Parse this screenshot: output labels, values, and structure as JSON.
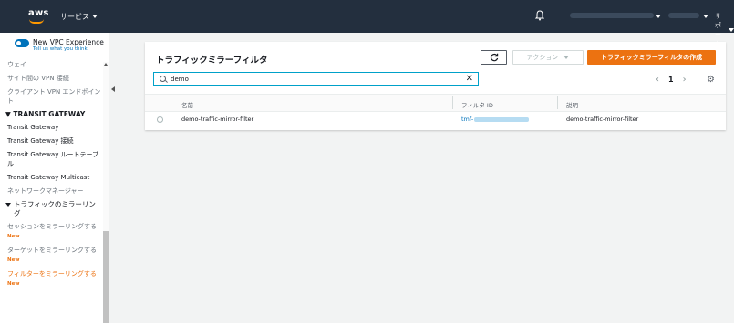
{
  "topnav": {
    "logo_text": "aws",
    "services_label": "サービス",
    "support_label": "サポート"
  },
  "sidebar": {
    "vpc_toggle": {
      "title": "New VPC Experience",
      "link": "Tell us what you think"
    },
    "items": [
      {
        "label": "ウェイ"
      },
      {
        "label": "サイト間の VPN 接続"
      },
      {
        "label": "クライアント VPN エンドポイント"
      }
    ],
    "transit_header": "TRANSIT GATEWAY",
    "transit_items": [
      {
        "label": "Transit Gateway"
      },
      {
        "label": "Transit Gateway 接続"
      },
      {
        "label": "Transit Gateway ルートテーブル"
      },
      {
        "label": "Transit Gateway Multicast"
      },
      {
        "label": "ネットワークマネージャー"
      }
    ],
    "mirroring_header": "トラフィックのミラーリング",
    "mirroring_items": [
      {
        "label": "セッションをミラーリングする",
        "badge": "New"
      },
      {
        "label": "ターゲットをミラーリングする",
        "badge": "New"
      },
      {
        "label": "フィルターをミラーリングする",
        "badge": "New"
      }
    ]
  },
  "panel": {
    "title": "トラフィックミラーフィルタ",
    "actions_label": "アクション",
    "create_label": "トラフィックミラーフィルタの作成",
    "search_value": "demo",
    "page_number": "1",
    "columns": [
      "名前",
      "フィルタ ID",
      "説明"
    ],
    "rows": [
      {
        "name": "demo-traffic-mirror-filter",
        "filter_id_prefix": "tmf-",
        "description": "demo-traffic-mirror-filter"
      }
    ]
  },
  "colors": {
    "nav_bg": "#232f3e",
    "accent": "#ec7211",
    "link": "#0073bb"
  }
}
